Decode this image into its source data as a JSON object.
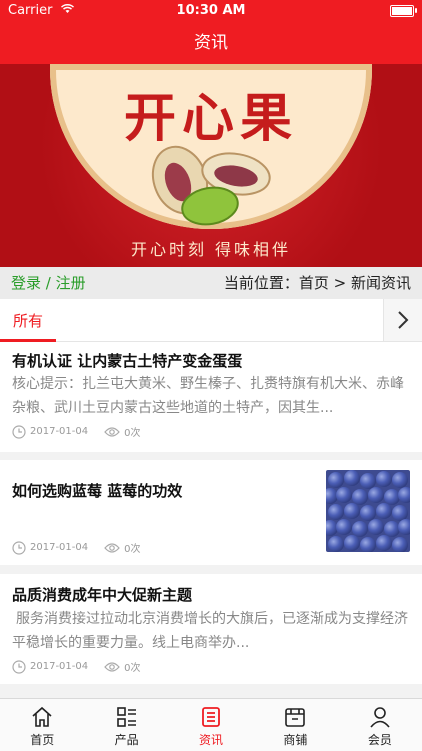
{
  "status": {
    "carrier": "Carrier",
    "time": "10:30 AM"
  },
  "navbar": {
    "title": "资讯"
  },
  "banner": {
    "title": "开心果",
    "slogan": "开心时刻 得味相伴"
  },
  "location": {
    "login": "登录 / 注册",
    "current": "当前位置：首页 > 新闻资讯"
  },
  "tabs": {
    "all": "所有"
  },
  "articles": [
    {
      "title": "有机认证 让内蒙古土特产变金蛋蛋",
      "summary": "核心提示：扎兰屯大黄米、野生榛子、扎赉特旗有机大米、赤峰杂粮、武川土豆内蒙古这些地道的土特产，因其生...",
      "date": "2017-01-04",
      "views": "0次"
    },
    {
      "title": "如何选购蓝莓 蓝莓的功效",
      "date": "2017-01-04",
      "views": "0次"
    },
    {
      "title": "品质消费成年中大促新主题",
      "summary": "服务消费接过拉动北京消费增长的大旗后，已逐渐成为支撑经济平稳增长的重要力量。线上电商举办...",
      "date": "2017-01-04",
      "views": "0次"
    }
  ],
  "tabbar": [
    {
      "label": "首页",
      "icon": "home-icon"
    },
    {
      "label": "产品",
      "icon": "grid-list-icon"
    },
    {
      "label": "资讯",
      "icon": "news-icon",
      "active": true
    },
    {
      "label": "商铺",
      "icon": "shop-icon"
    },
    {
      "label": "会员",
      "icon": "user-icon"
    }
  ],
  "colors": {
    "accent": "#ef1c22",
    "login_green": "#2a9d2a"
  }
}
